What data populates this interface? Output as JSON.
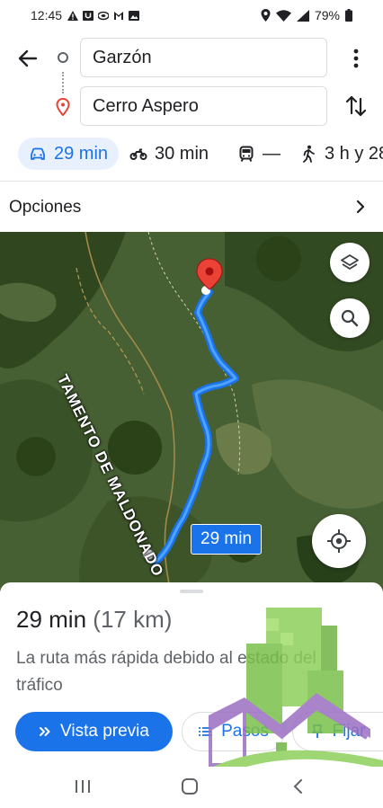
{
  "status_bar": {
    "time": "12:45",
    "notification_icons": [
      "warning-icon",
      "u-app-icon",
      "storage-icon",
      "gmail-icon",
      "image-icon"
    ],
    "battery": "79%",
    "system_icons": [
      "location-icon",
      "wifi-icon",
      "signal-icon",
      "battery-icon"
    ]
  },
  "route": {
    "origin": "Garzón",
    "destination": "Cerro Aspero"
  },
  "modes": [
    {
      "icon": "car-icon",
      "label": "29 min",
      "selected": true
    },
    {
      "icon": "motorcycle-icon",
      "label": "30 min",
      "selected": false
    },
    {
      "icon": "train-icon",
      "label": "—",
      "selected": false
    },
    {
      "icon": "walk-icon",
      "label": "3 h y 28",
      "selected": false
    }
  ],
  "options": {
    "label": "Opciones"
  },
  "map": {
    "region_label": "TAMENTO DE MALDONADO",
    "duration_chip": "29 min",
    "route_color": "#1a73e8",
    "pin_color": "#ea4335"
  },
  "sheet": {
    "duration": "29 min",
    "distance": "(17 km)",
    "description": "La ruta más rápida debido al estado del tráfico",
    "preview_button": "Vista previa",
    "steps_button": "Pasos",
    "pin_button": "Fijar"
  },
  "colors": {
    "accent": "#1a73e8",
    "accent_light": "#e8f0fe"
  }
}
